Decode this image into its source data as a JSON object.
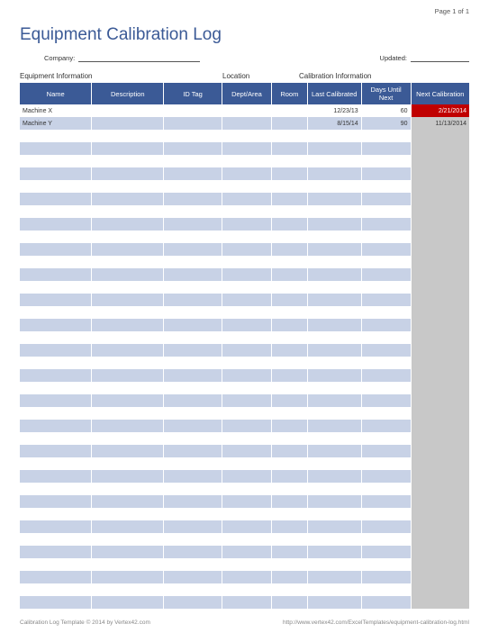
{
  "header": {
    "page_label": "Page 1 of 1",
    "title": "Equipment Calibration Log",
    "company_label": "Company:",
    "company_value": "",
    "updated_label": "Updated:",
    "updated_value": ""
  },
  "section_headers": {
    "equipment": "Equipment Information",
    "location": "Location",
    "calibration": "Calibration Information"
  },
  "columns": {
    "name": "Name",
    "description": "Description",
    "idtag": "ID Tag",
    "dept": "Dept/Area",
    "room": "Room",
    "last_calibrated": "Last Calibrated",
    "days_until_next": "Days Until Next",
    "next_calibration": "Next Calibration"
  },
  "rows": [
    {
      "name": "Machine X",
      "description": "",
      "idtag": "",
      "dept": "",
      "room": "",
      "last_calibrated": "12/23/13",
      "days_until_next": "60",
      "next_calibration": "2/21/2014",
      "overdue": true
    },
    {
      "name": "Machine Y",
      "description": "",
      "idtag": "",
      "dept": "",
      "room": "",
      "last_calibrated": "8/15/14",
      "days_until_next": "90",
      "next_calibration": "11/13/2014",
      "overdue": false
    }
  ],
  "empty_row_count": 38,
  "footer": {
    "left": "Calibration Log Template © 2014 by Vertex42.com",
    "right": "http://www.vertex42.com/ExcelTemplates/equipment-calibration-log.html"
  }
}
